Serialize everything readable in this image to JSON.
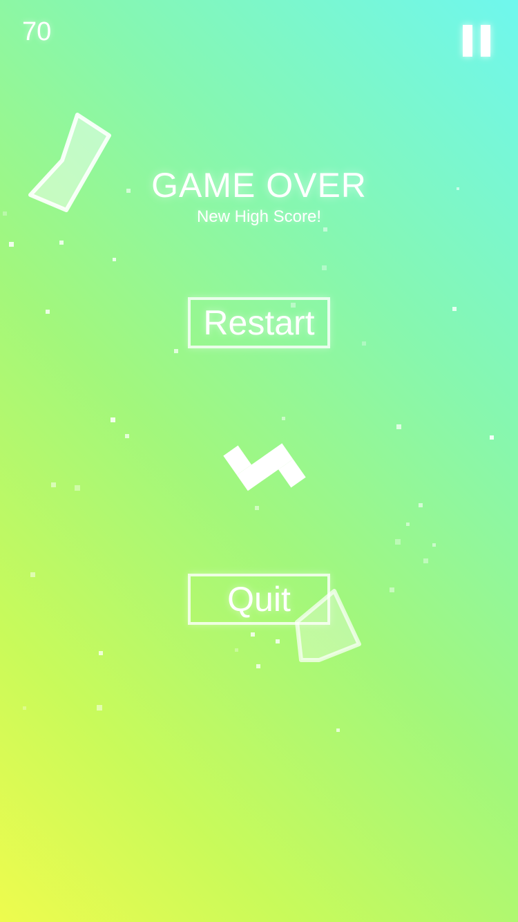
{
  "hud": {
    "score": "70",
    "pause_icon": "pause-icon"
  },
  "game_over": {
    "title": "GAME OVER",
    "subtitle": "New High Score!"
  },
  "menu": {
    "restart_label": "Restart",
    "quit_label": "Quit"
  },
  "colors": {
    "gradient_top_right": "#6ff7ee",
    "gradient_middle": "#a2f77c",
    "gradient_bottom_left": "#eefb4e",
    "foreground": "#ffffff"
  }
}
